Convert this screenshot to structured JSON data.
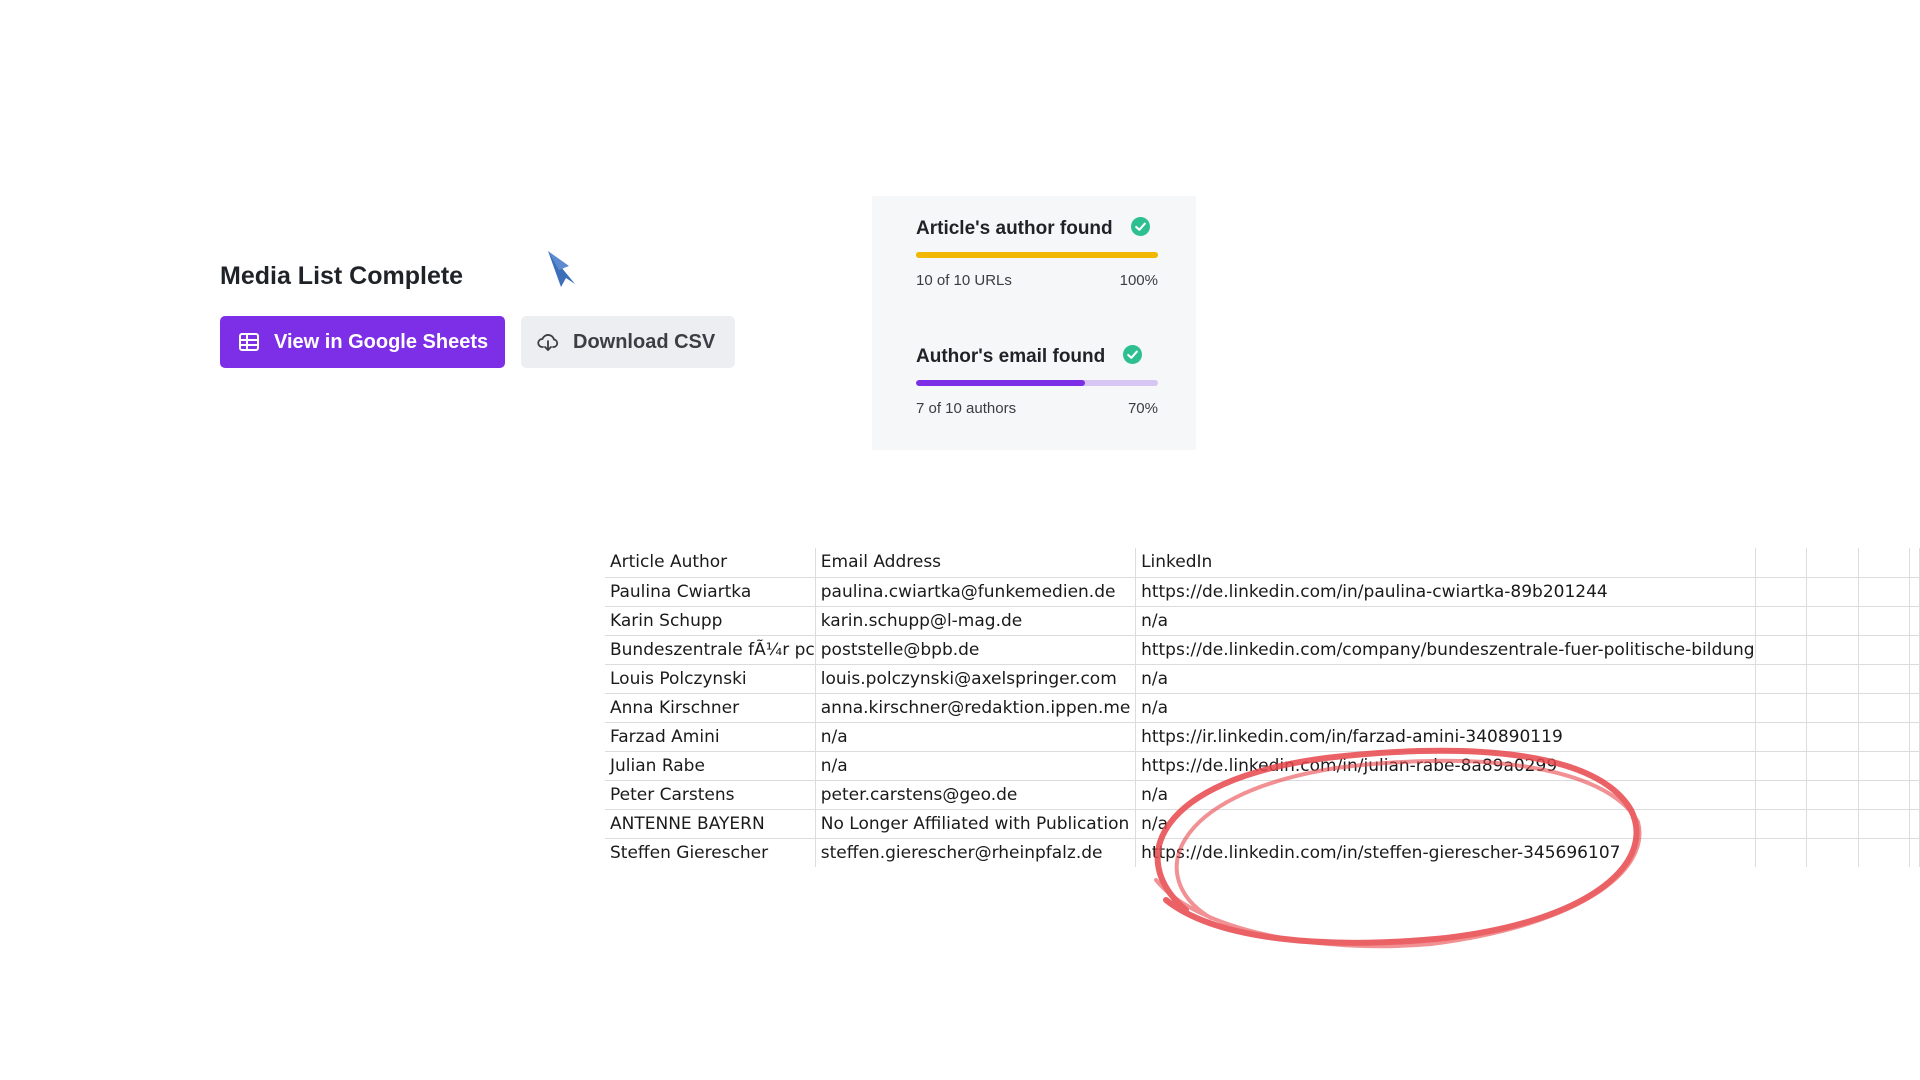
{
  "media": {
    "title": "Media List Complete"
  },
  "actions": {
    "sheets_label": "View in Google Sheets",
    "csv_label": "Download CSV"
  },
  "progress": {
    "author": {
      "title": "Article's author found",
      "count_text": "10 of 10 URLs",
      "percent_text": "100%",
      "fraction": 1.0,
      "color": "#f2b800",
      "track_color": "#f2b800"
    },
    "email": {
      "title": "Author's email found",
      "count_text": "7 of 10 authors",
      "percent_text": "70%",
      "fraction": 0.7,
      "color": "#7c2fe6",
      "track_color": "#d7c5f3"
    },
    "check_color": "#2ebf91"
  },
  "table": {
    "headers": [
      "Article Author",
      "Email Address",
      "LinkedIn"
    ],
    "rows": [
      [
        "Paulina Cwiartka",
        "paulina.cwiartka@funkemedien.de",
        "https://de.linkedin.com/in/paulina-cwiartka-89b201244"
      ],
      [
        "Karin Schupp",
        "karin.schupp@l-mag.de",
        "n/a"
      ],
      [
        "Bundeszentrale fÃ¼r pc",
        "poststelle@bpb.de",
        "https://de.linkedin.com/company/bundeszentrale-fuer-politische-bildung"
      ],
      [
        "Louis Polczynski",
        "louis.polczynski@axelspringer.com",
        "n/a"
      ],
      [
        "Anna Kirschner",
        "anna.kirschner@redaktion.ippen.me",
        "n/a"
      ],
      [
        "Farzad Amini",
        "n/a",
        "https://ir.linkedin.com/in/farzad-amini-340890119"
      ],
      [
        "Julian Rabe",
        "n/a",
        "https://de.linkedin.com/in/julian-rabe-8a89a0299"
      ],
      [
        "Peter Carstens",
        "peter.carstens@geo.de",
        "n/a"
      ],
      [
        "ANTENNE BAYERN",
        "No Longer Affiliated with Publication",
        "n/a"
      ],
      [
        "Steffen Gierescher",
        "steffen.gierescher@rheinpfalz.de",
        "https://de.linkedin.com/in/steffen-gierescher-345696107"
      ]
    ]
  },
  "icons": {
    "sheets": "grid-table-icon",
    "csv": "cloud-download-icon",
    "cursor": "mouse-pointer-icon",
    "check": "check-circle-icon"
  },
  "colors": {
    "annotation": "#e8474c"
  }
}
